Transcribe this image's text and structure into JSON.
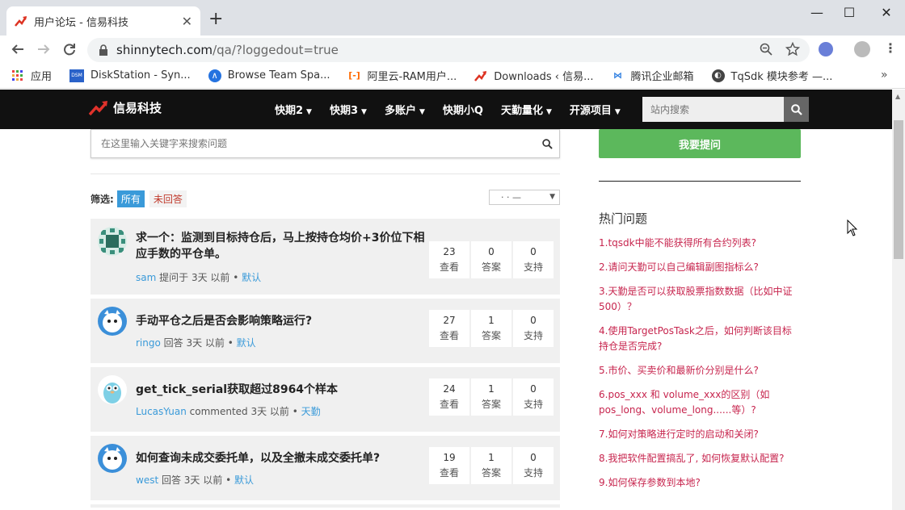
{
  "browser": {
    "tab_title": "用户论坛 - 信易科技",
    "tab_close": "✕",
    "new_tab": "+",
    "url_main": "shinnytech.com",
    "url_path": "/qa/?loggedout=true",
    "win_min": "—",
    "win_max": "☐",
    "win_close": "✕"
  },
  "bookmarks": [
    {
      "label": "应用"
    },
    {
      "label": "DiskStation - Syn..."
    },
    {
      "label": "Browse Team Spa..."
    },
    {
      "label": "阿里云-RAM用户..."
    },
    {
      "label": "Downloads ‹ 信易..."
    },
    {
      "label": "腾讯企业邮箱"
    },
    {
      "label": "TqSdk 模块参考 —..."
    }
  ],
  "site": {
    "logo_text": "信易科技",
    "menu": [
      {
        "label": "快期2",
        "dropdown": true
      },
      {
        "label": "快期3",
        "dropdown": true
      },
      {
        "label": "多账户",
        "dropdown": true
      },
      {
        "label": "快期小Q",
        "dropdown": false
      },
      {
        "label": "天勤量化",
        "dropdown": true
      },
      {
        "label": "开源项目",
        "dropdown": true
      }
    ],
    "search_placeholder": "站内搜索"
  },
  "main": {
    "search_placeholder": "在这里输入关键字来搜索问题",
    "filter_label": "筛选:",
    "filter_all": "所有",
    "filter_unanswered": "未回答",
    "sort_value": "· · —",
    "questions": [
      {
        "title": "求一个：监测到目标持仓后，马上按持仓均价+3价位下相应手数的平仓单。",
        "user": "sam",
        "action": "提问于 3天 以前 •",
        "category": "默认",
        "views": "23",
        "answers": "0",
        "votes": "0"
      },
      {
        "title": "手动平仓之后是否会影响策略运行?",
        "user": "ringo",
        "action": "回答 3天 以前 •",
        "category": "默认",
        "views": "27",
        "answers": "1",
        "votes": "0"
      },
      {
        "title": "get_tick_serial获取超过8964个样本",
        "user": "LucasYuan",
        "action": "commented 3天 以前 •",
        "category": "天勤",
        "views": "24",
        "answers": "1",
        "votes": "0"
      },
      {
        "title": "如何查询未成交委托单，以及全撤未成交委托单?",
        "user": "west",
        "action": "回答 3天 以前 •",
        "category": "默认",
        "views": "19",
        "answers": "1",
        "votes": "0"
      }
    ],
    "stat_labels": {
      "views": "查看",
      "answers": "答案",
      "votes": "支持"
    }
  },
  "sidebar": {
    "ask_button": "我要提问",
    "hot_title": "热门问题",
    "hot": [
      "1.tqsdk中能不能获得所有合约列表?",
      "2.请问天勤可以自己编辑副图指标么?",
      "3.天勤是否可以获取股票指数数据（比如中证500）？",
      "4.使用TargetPosTask之后，如何判断该目标持仓是否完成?",
      "5.市价、买卖价和最新价分别是什么?",
      "6.pos_xxx 和 volume_xxx的区别（如pos_long、volume_long......等）?",
      "7.如何对策略进行定时的启动和关闭?",
      "8.我把软件配置搞乱了, 如何恢复默认配置?",
      "9.如何保存参数到本地?"
    ]
  },
  "colors": {
    "nav_bg": "#111111",
    "accent_blue": "#3a9ad9",
    "ask_green": "#5cb85c",
    "hot_link": "#c7254e"
  }
}
